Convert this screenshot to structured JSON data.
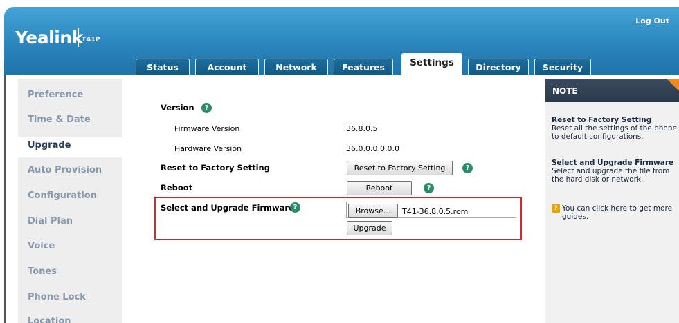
{
  "header": {
    "logo": "Yealink",
    "model": "T41P",
    "logout": "Log Out"
  },
  "tabs": [
    {
      "label": "Status"
    },
    {
      "label": "Account"
    },
    {
      "label": "Network"
    },
    {
      "label": "Features"
    },
    {
      "label": "Settings",
      "active": true
    },
    {
      "label": "Directory"
    },
    {
      "label": "Security"
    }
  ],
  "sidebar": {
    "items": [
      {
        "label": "Preference"
      },
      {
        "label": "Time & Date"
      },
      {
        "label": "Upgrade",
        "active": true
      },
      {
        "label": "Auto Provision"
      },
      {
        "label": "Configuration"
      },
      {
        "label": "Dial Plan"
      },
      {
        "label": "Voice"
      },
      {
        "label": "Tones"
      },
      {
        "label": "Phone Lock"
      },
      {
        "label": "Location"
      }
    ]
  },
  "main": {
    "version_label": "Version",
    "firmware_label": "Firmware Version",
    "firmware_value": "36.8.0.5",
    "hardware_label": "Hardware Version",
    "hardware_value": "36.0.0.0.0.0.0",
    "reset_label": "Reset to Factory Setting",
    "reset_button": "Reset to Factory Setting",
    "reboot_label": "Reboot",
    "reboot_button": "Reboot",
    "upgrade_label": "Select and Upgrade Firmware",
    "browse_button": "Browse...",
    "file_name": "T41-36.8.0.5.rom",
    "upgrade_button": "Upgrade",
    "help_glyph": "?"
  },
  "note": {
    "title": "NOTE",
    "reset_heading": "Reset to Factory Setting",
    "reset_text": "Reset all the settings of the phone to default configurations.",
    "upgrade_heading": "Select and Upgrade Firmware",
    "upgrade_text": "Select and upgrade the file from the hard disk or network.",
    "guide_icon_glyph": "?",
    "guide_text": "You can click here to get more guides."
  },
  "colors": {
    "header_blue": "#2a86bd",
    "tab_dark": "#135a85",
    "highlight_red": "#d4262c",
    "help_green": "#2d8a6a",
    "note_orange": "#f08a1c"
  }
}
